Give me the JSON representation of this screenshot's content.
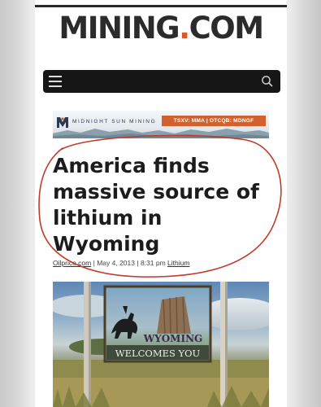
{
  "site": {
    "logo_text": "MINING",
    "logo_dot": ".",
    "logo_suffix": "COM",
    "accent_color": "#d9582b"
  },
  "navbar": {
    "menu_icon": "hamburger-menu-icon",
    "search_icon": "search-icon"
  },
  "ad": {
    "brand": "MIDNIGHT SUN MINING",
    "ticker": "TSXV: MMA | OTCQB: MDNGF",
    "ticker_color": "#d1622d"
  },
  "article": {
    "headline": "America finds massive source of lithium in Wyoming",
    "author": "Oilprice.com",
    "date": "May 4, 2013",
    "time": "8:31 pm",
    "separator": "|",
    "category": "Lithium"
  },
  "image": {
    "sign_line1": "WYOMING",
    "sign_line2": "WELCOMES YOU"
  }
}
